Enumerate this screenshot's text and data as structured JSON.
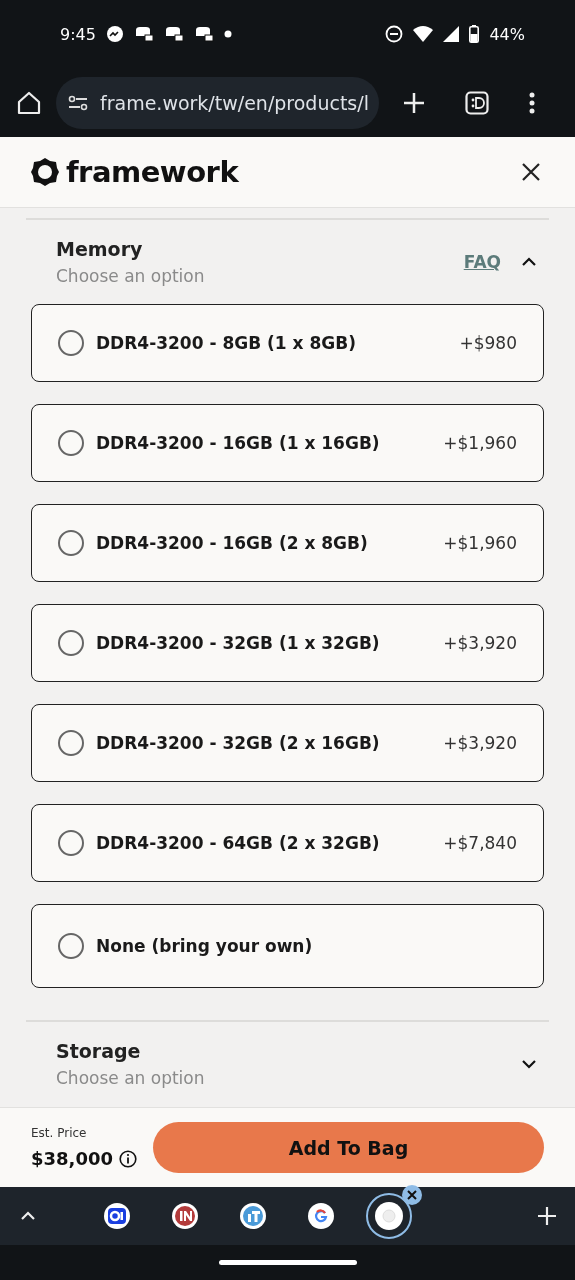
{
  "status_bar": {
    "time": "9:45",
    "battery": "44%"
  },
  "browser": {
    "url": "frame.work/tw/en/products/l"
  },
  "header": {
    "brand": "framework"
  },
  "sections": [
    {
      "title": "Memory",
      "subtitle": "Choose an option",
      "faq": "FAQ",
      "expanded": true,
      "options": [
        {
          "label": "DDR4-3200 - 8GB (1 x 8GB)",
          "price": "+$980",
          "selected": false
        },
        {
          "label": "DDR4-3200 - 16GB (1 x 16GB)",
          "price": "+$1,960",
          "selected": false
        },
        {
          "label": "DDR4-3200 - 16GB (2 x 8GB)",
          "price": "+$1,960",
          "selected": false
        },
        {
          "label": "DDR4-3200 - 32GB (1 x 32GB)",
          "price": "+$3,920",
          "selected": false
        },
        {
          "label": "DDR4-3200 - 32GB (2 x 16GB)",
          "price": "+$3,920",
          "selected": false
        },
        {
          "label": "DDR4-3200 - 64GB (2 x 32GB)",
          "price": "+$7,840",
          "selected": false
        },
        {
          "label": "None (bring your own)",
          "selected": false
        }
      ]
    },
    {
      "title": "Storage",
      "subtitle": "Choose an option",
      "expanded": false
    }
  ],
  "price_bar": {
    "label": "Est. Price",
    "price": "$38,000",
    "button": "Add To Bag"
  },
  "tab_strip": [
    {
      "kind": "blue",
      "selected": false
    },
    {
      "kind": "red",
      "selected": false
    },
    {
      "kind": "sky",
      "selected": false
    },
    {
      "kind": "google",
      "selected": false
    },
    {
      "kind": "white",
      "selected": true
    }
  ]
}
